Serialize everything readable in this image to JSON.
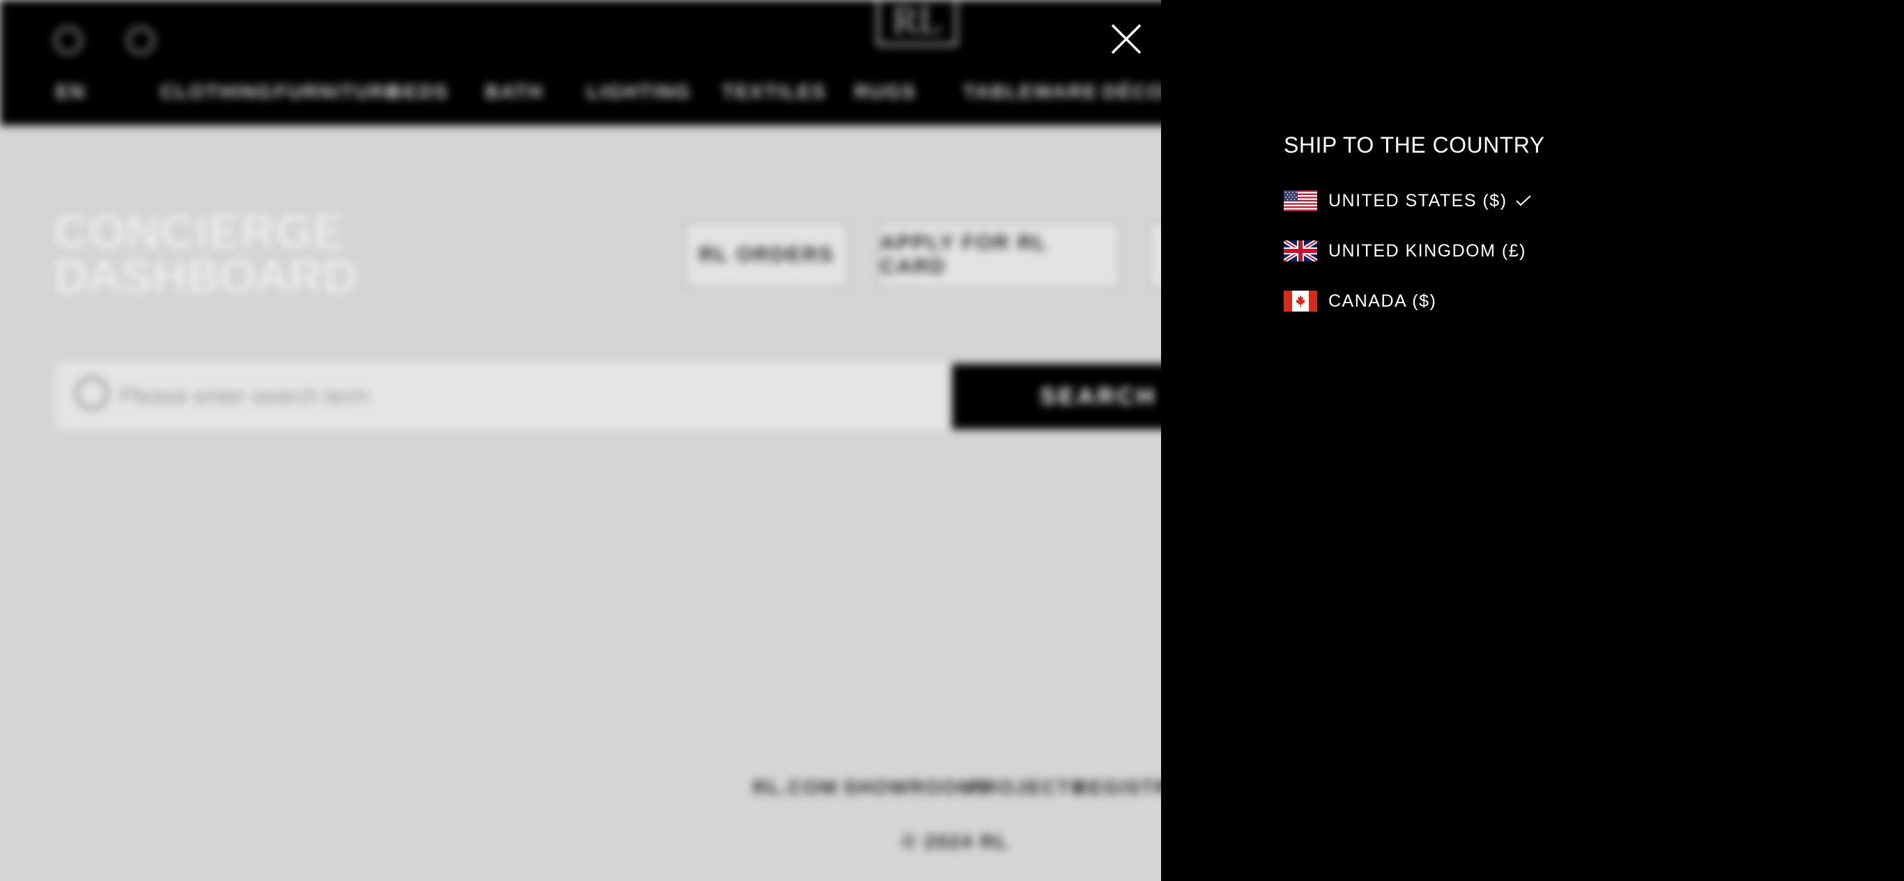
{
  "background_page": {
    "logo": "RL",
    "nav_items": [
      "EN",
      "CLOTHING",
      "FURNITURE",
      "BEDS",
      "BATH",
      "LIGHTING",
      "TEXTILES",
      "RUGS",
      "TABLEWARE",
      "DÉCOR"
    ],
    "page_title_line1": "CONCIERGE",
    "page_title_line2": "DASHBOARD",
    "buttons": [
      "RL ORDERS",
      "APPLY FOR RL CARD"
    ],
    "search_placeholder": "Please enter search term",
    "search_button": "SEARCH",
    "footer_links": [
      "RL.COM",
      "SHOWROOMS",
      "PROJECTS",
      "REGISTRY"
    ],
    "copyright": "© 2024 RL"
  },
  "ship_panel": {
    "title": "SHIP TO THE COUNTRY",
    "close_icon": "close-icon",
    "countries": [
      {
        "label": "UNITED STATES ($)",
        "flag": "us-flag-icon",
        "selected": true
      },
      {
        "label": "UNITED KINGDOM (£)",
        "flag": "uk-flag-icon",
        "selected": false
      },
      {
        "label": "CANADA ($)",
        "flag": "canada-flag-icon",
        "selected": false
      }
    ]
  }
}
